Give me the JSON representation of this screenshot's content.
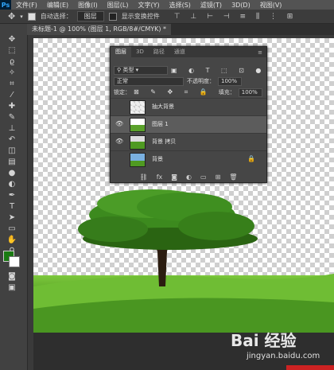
{
  "app": {
    "logo": "Ps"
  },
  "menu": [
    "文件(F)",
    "编辑(E)",
    "图像(I)",
    "图层(L)",
    "文字(Y)",
    "选择(S)",
    "滤镜(T)",
    "3D(D)",
    "视图(V)"
  ],
  "options_bar": {
    "auto_select_label": "自动选择：",
    "auto_select_value": "图层",
    "show_transform_label": "显示变换控件"
  },
  "document_tab": {
    "title": "未标题-1 @ 100% (图层 1, RGB/8#/CMYK) *"
  },
  "layers_panel": {
    "tabs": [
      "图层",
      "3D",
      "路径",
      "通道"
    ],
    "filter_kind": "类型",
    "blend_mode": "正常",
    "opacity_label": "不透明度：",
    "opacity_value": "100%",
    "lock_label": "锁定：",
    "fill_label": "填充：",
    "fill_value": "100%",
    "layers": [
      {
        "name": "抽大背景",
        "visible": false,
        "selected": false,
        "locked": false
      },
      {
        "name": "图层 1",
        "visible": true,
        "selected": true,
        "locked": false
      },
      {
        "name": "背景 拷贝",
        "visible": true,
        "selected": false,
        "locked": false
      },
      {
        "name": "背景",
        "visible": false,
        "selected": false,
        "locked": true
      }
    ]
  },
  "watermark": {
    "brand": "Bai 经验",
    "url": "jingyan.baidu.com"
  },
  "colors": {
    "foreground": "#1a7a12",
    "background": "#ffffff",
    "accent": "#31a8ff"
  }
}
